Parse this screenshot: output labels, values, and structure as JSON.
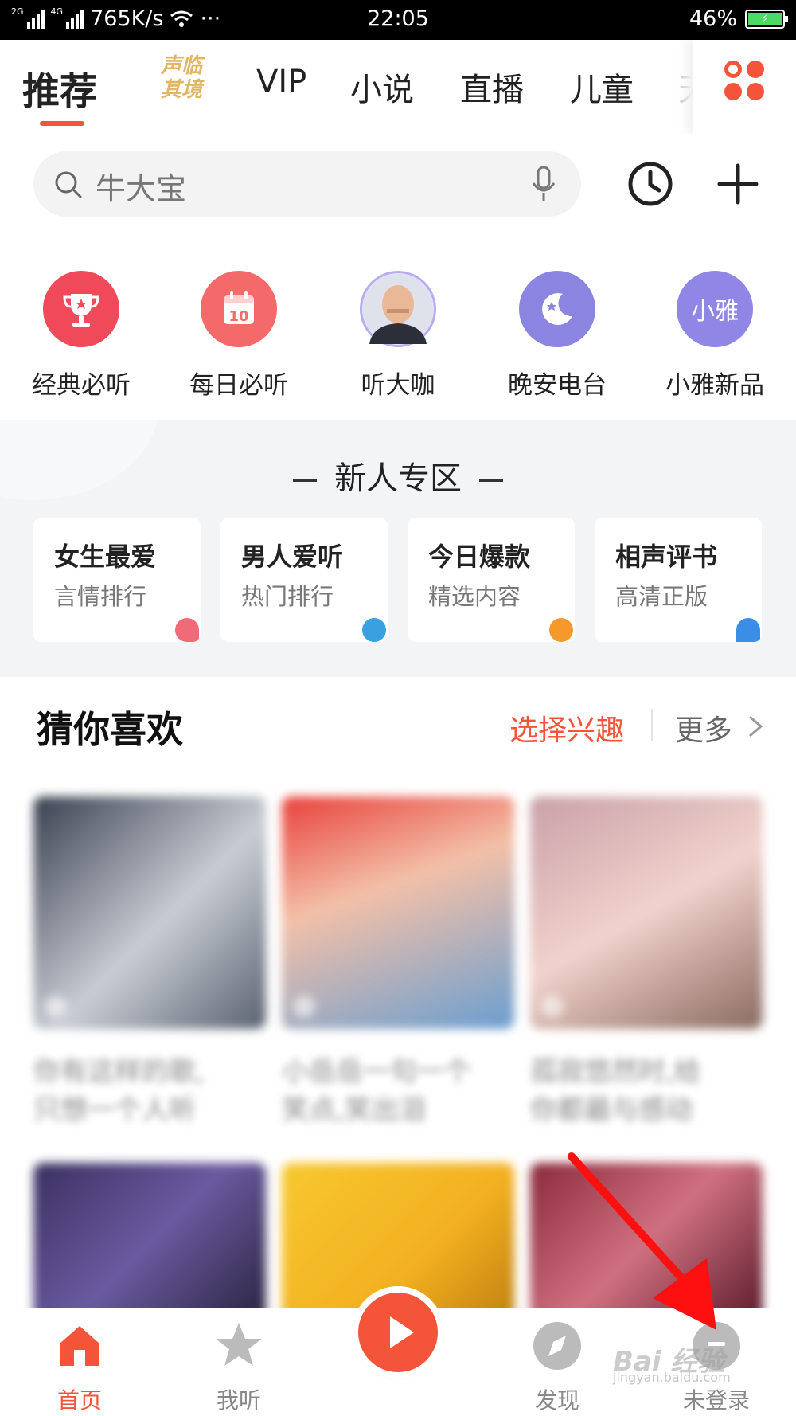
{
  "status_bar": {
    "net_tag_1": "2G",
    "net_tag_2": "4G",
    "speed": "765K/s",
    "dots": "···",
    "time": "22:05",
    "battery": "46%"
  },
  "tabs": {
    "items": [
      "推荐",
      "VIP",
      "小说",
      "直播",
      "儿童",
      "天"
    ],
    "promo_line1": "声临",
    "promo_line2": "其境",
    "active_index": 0
  },
  "search": {
    "placeholder": "牛大宝"
  },
  "quick_entries": [
    {
      "label": "经典必听",
      "icon": "trophy-icon",
      "color": "#f04a5a"
    },
    {
      "label": "每日必听",
      "icon": "calendar-icon",
      "color": "#f46a6a",
      "badge": "10"
    },
    {
      "label": "听大咖",
      "icon": "avatar-photo",
      "color": "#e8e4ff"
    },
    {
      "label": "晚安电台",
      "icon": "moon-icon",
      "color": "#8b84e0"
    },
    {
      "label": "小雅新品",
      "icon": "xiaoya-icon",
      "color": "#8f86e6",
      "badge": "小雅"
    }
  ],
  "new_user_zone": {
    "title": "新人专区",
    "cards": [
      {
        "title": "女生最爱",
        "subtitle": "言情排行",
        "accent": "#f06a7a"
      },
      {
        "title": "男人爱听",
        "subtitle": "热门排行",
        "accent": "#3aa0e0"
      },
      {
        "title": "今日爆款",
        "subtitle": "精选内容",
        "accent": "#f59a2a"
      },
      {
        "title": "相声评书",
        "subtitle": "高清正版",
        "accent": "#3a8ee6"
      }
    ]
  },
  "guess_you_like": {
    "title": "猜你喜欢",
    "choose_interest": "选择兴趣",
    "more": "更多",
    "captions": [
      [
        "你有这样的歌,",
        "只想一个人听"
      ],
      [
        "小岳岳一句一个",
        "笑点,笑出泪"
      ],
      [
        "孤寂悠然时,给",
        "你都最与感动"
      ]
    ]
  },
  "bottom_nav": {
    "items": [
      "首页",
      "我听",
      "",
      "发现",
      "未登录"
    ]
  },
  "watermark": {
    "text": "Bai 经验",
    "sub": "jingyan.baidu.com"
  },
  "colors": {
    "accent": "#f4553a",
    "zone_bg": "#f3f4f6"
  }
}
